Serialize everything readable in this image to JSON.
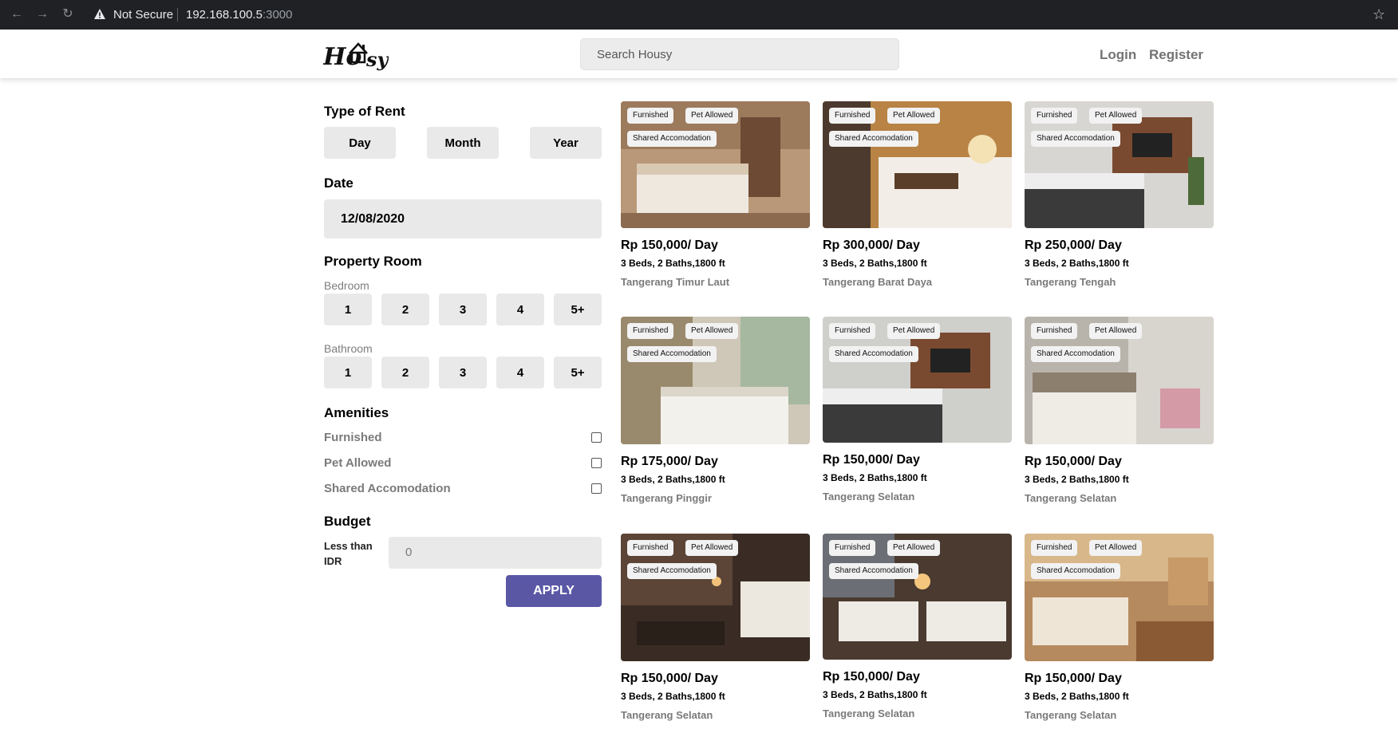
{
  "browser": {
    "security_label": "Not Secure",
    "url_host": "192.168.100.5",
    "url_port": ":3000"
  },
  "header": {
    "search_placeholder": "Search Housy",
    "login_label": "Login",
    "register_label": "Register"
  },
  "filters": {
    "type_title": "Type of Rent",
    "type_options": [
      "Day",
      "Month",
      "Year"
    ],
    "date_title": "Date",
    "date_value": "12/08/2020",
    "room_title": "Property Room",
    "bedroom_label": "Bedroom",
    "bedroom_options": [
      "1",
      "2",
      "3",
      "4",
      "5+"
    ],
    "bathroom_label": "Bathroom",
    "bathroom_options": [
      "1",
      "2",
      "3",
      "4",
      "5+"
    ],
    "amenities_title": "Amenities",
    "amenities": [
      "Furnished",
      "Pet Allowed",
      "Shared Accomodation"
    ],
    "budget_title": "Budget",
    "budget_label_line1": "Less than",
    "budget_label_line2": "IDR",
    "budget_value": "0",
    "apply_label": "APPLY"
  },
  "listings": [
    {
      "tags": [
        "Furnished",
        "Pet Allowed",
        "Shared Accomodation"
      ],
      "price": "Rp 150,000/ Day",
      "specs": "3 Beds, 2 Baths,1800 ft",
      "location": "Tangerang Timur Laut"
    },
    {
      "tags": [
        "Furnished",
        "Pet Allowed",
        "Shared Accomodation"
      ],
      "price": "Rp 300,000/ Day",
      "specs": "3 Beds, 2 Baths,1800 ft",
      "location": "Tangerang Barat Daya"
    },
    {
      "tags": [
        "Furnished",
        "Pet Allowed",
        "Shared Accomodation"
      ],
      "price": "Rp 250,000/ Day",
      "specs": "3 Beds, 2 Baths,1800 ft",
      "location": "Tangerang Tengah"
    },
    {
      "tags": [
        "Furnished",
        "Pet Allowed",
        "Shared Accomodation"
      ],
      "price": "Rp 175,000/ Day",
      "specs": "3 Beds, 2 Baths,1800 ft",
      "location": "Tangerang Pinggir"
    },
    {
      "tags": [
        "Furnished",
        "Pet Allowed",
        "Shared Accomodation"
      ],
      "price": "Rp 150,000/ Day",
      "specs": "3 Beds, 2 Baths,1800 ft",
      "location": "Tangerang Selatan"
    },
    {
      "tags": [
        "Furnished",
        "Pet Allowed",
        "Shared Accomodation"
      ],
      "price": "Rp 150,000/ Day",
      "specs": "3 Beds, 2 Baths,1800 ft",
      "location": "Tangerang Selatan"
    },
    {
      "tags": [
        "Furnished",
        "Pet Allowed",
        "Shared Accomodation"
      ],
      "price": "Rp 150,000/ Day",
      "specs": "3 Beds, 2 Baths,1800 ft",
      "location": "Tangerang Selatan"
    },
    {
      "tags": [
        "Furnished",
        "Pet Allowed",
        "Shared Accomodation"
      ],
      "price": "Rp 150,000/ Day",
      "specs": "3 Beds, 2 Baths,1800 ft",
      "location": "Tangerang Selatan"
    },
    {
      "tags": [
        "Furnished",
        "Pet Allowed",
        "Shared Accomodation"
      ],
      "price": "Rp 150,000/ Day",
      "specs": "3 Beds, 2 Baths,1800 ft",
      "location": "Tangerang Selatan"
    }
  ],
  "colors": {
    "accent": "#5a58a5",
    "chrome_bg": "#202124",
    "button_bg": "#e9e9e9",
    "muted_text": "#7a7a7a"
  }
}
